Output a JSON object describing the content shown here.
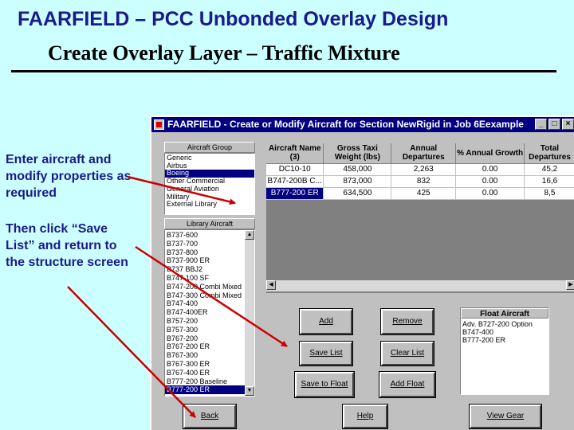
{
  "slide": {
    "title": "FAARFIELD – PCC Unbonded Overlay Design",
    "subtitle": "Create Overlay Layer – Traffic Mixture",
    "note1": "Enter aircraft and modify properties as required",
    "note2": "Then click “Save List” and return to the structure screen"
  },
  "window": {
    "title": "FAARFIELD - Create or Modify Aircraft for Section NewRigid in Job 6Eexample",
    "min": "_",
    "max": "□",
    "close": "×"
  },
  "aircraft_group": {
    "header": "Aircraft Group",
    "items": [
      "Generic",
      "Airbus",
      "Boeing",
      "Other Commercial",
      "General Aviation",
      "Military",
      "External Library"
    ],
    "selected_index": 2
  },
  "library": {
    "header": "Library Aircraft",
    "items": [
      "B737-600",
      "B737-700",
      "B737-800",
      "B737-900 ER",
      "B737 BBJ2",
      "B747-100 SF",
      "B747-200 Combi Mixed",
      "B747-300 Combi Mixed",
      "B747-400",
      "B747-400ER",
      "B757-200",
      "B757-300",
      "B767-200",
      "B767-200 ER",
      "B767-300",
      "B767-300 ER",
      "B767-400 ER",
      "B777-200 Baseline",
      "B777-200 ER"
    ],
    "selected_index": 18
  },
  "grid": {
    "headers": [
      "Aircraft Name (3)",
      "Gross Taxi Weight (lbs)",
      "Annual Departures",
      "% Annual Growth",
      "Total Departures"
    ],
    "rows": [
      [
        "DC10-10",
        "458,000",
        "2,263",
        "0.00",
        "45,2"
      ],
      [
        "B747-200B C...",
        "873,000",
        "832",
        "0.00",
        "16,6"
      ],
      [
        "B777-200 ER",
        "634,500",
        "425",
        "0.00",
        "8,5"
      ]
    ],
    "selected_row": 2
  },
  "buttons": {
    "add": "Add",
    "remove": "Remove",
    "save_list": "Save List",
    "clear_list": "Clear List",
    "save_to_float": "Save to Float",
    "add_float": "Add Float",
    "back": "Back",
    "help": "Help",
    "view_gear": "View Gear"
  },
  "float_aircraft": {
    "header": "Float Aircraft",
    "items": [
      "Adv. B727-200 Option",
      "B747-400",
      "B777-200 ER"
    ]
  },
  "colors": {
    "background": "#ccffff",
    "title_blue": "#1a1a8c",
    "titlebar": "#000080",
    "arrow": "#cc0000"
  }
}
